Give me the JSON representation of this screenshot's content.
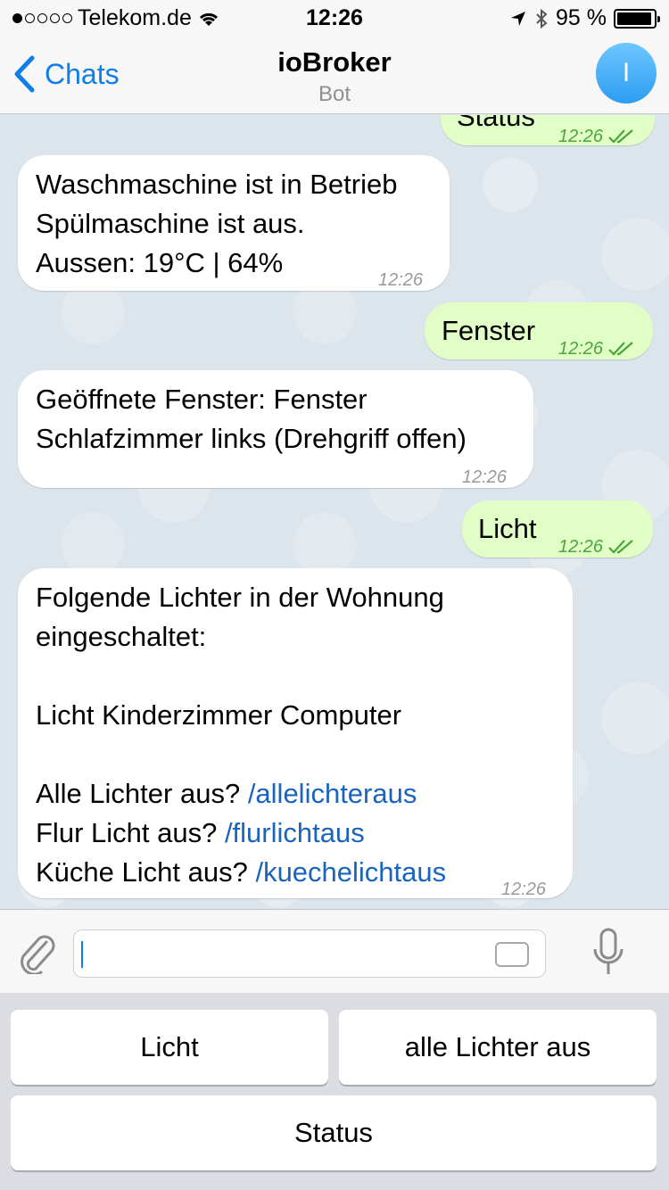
{
  "status_bar": {
    "carrier": "Telekom.de",
    "time": "12:26",
    "battery": "95 %",
    "battery_level": 0.95,
    "signal_icon": "signal-dots-icon",
    "wifi_icon": "wifi-icon",
    "location_icon": "location-arrow-icon",
    "bluetooth_icon": "bluetooth-icon"
  },
  "nav": {
    "back_label": "Chats",
    "title": "ioBroker",
    "subtitle": "Bot",
    "avatar_initial": "I"
  },
  "messages": [
    {
      "dir": "out",
      "lines": [
        "Status"
      ],
      "time": "12:26"
    },
    {
      "dir": "in",
      "lines": [
        "Waschmaschine ist in Betrieb",
        "Spülmaschine ist aus.",
        "Aussen: 19°C | 64%"
      ],
      "time": "12:26"
    },
    {
      "dir": "out",
      "lines": [
        "Fenster"
      ],
      "time": "12:26"
    },
    {
      "dir": "in",
      "lines": [
        "Geöffnete Fenster: Fenster",
        "Schlafzimmer links (Drehgriff offen)"
      ],
      "time": "12:26"
    },
    {
      "dir": "out",
      "lines": [
        "Licht"
      ],
      "time": "12:26"
    },
    {
      "dir": "in",
      "lines": [
        "Folgende Lichter in der Wohnung",
        "eingeschaltet:",
        "Licht Kinderzimmer Computer"
      ],
      "commands": [
        {
          "text": "Alle Lichter aus? ",
          "link": "/allelichteraus"
        },
        {
          "text": "Flur Licht aus? ",
          "link": "/flurlichtaus"
        },
        {
          "text": "Küche Licht aus? ",
          "link": "/kuechelichtaus"
        }
      ],
      "time": "12:26"
    }
  ],
  "input": {
    "placeholder": ""
  },
  "keyboard": {
    "buttons": [
      "Licht",
      "alle Lichter aus",
      "Status"
    ]
  },
  "colors": {
    "accent": "#0f7ee9",
    "outgoing_bubble": "#e1fec6",
    "incoming_bubble": "#ffffff",
    "read_check": "#4aa63c",
    "link": "#1a63bf"
  }
}
